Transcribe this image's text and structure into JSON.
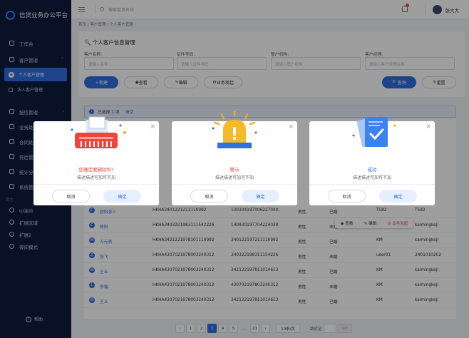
{
  "app": {
    "title": "信贷业务办公平台"
  },
  "sidebar": {
    "workbench": "工作台",
    "customer_mgmt": "客户管理",
    "personal_customer": "个人客户管理",
    "corporate_customer": "法人客户管理",
    "items": [
      "授信管理",
      "业务处理",
      "合同处理",
      "贷后管理",
      "统计分析",
      "系统管理"
    ],
    "section_other": "其它",
    "other_items": [
      "UI演示",
      "扩展区域",
      "扩展2",
      "夜间模式"
    ],
    "help": "帮助"
  },
  "topbar": {
    "search_placeholder": "搜索菜单名称",
    "username": "张大大"
  },
  "breadcrumb": "首页 / 客户管理 / 个人客户管理",
  "page": {
    "title": "个人客户信息管理",
    "fields": [
      {
        "label": "客户名称:",
        "placeholder": "请输入名称"
      },
      {
        "label": "证件号码:",
        "placeholder": "请输入证件号码"
      },
      {
        "label": "管户机构:",
        "placeholder": "请输入管户机构"
      },
      {
        "label": "客户经理:",
        "placeholder": "请输入客户经理名称"
      }
    ],
    "buttons": {
      "new": "新建",
      "view": "查看",
      "edit": "编辑",
      "business": "业务发起",
      "query": "查询",
      "reset": "重置"
    }
  },
  "selection": {
    "text": "已选择 1 项",
    "clear": "清空"
  },
  "table_rows": [
    {
      "initial": "C",
      "name": "欧阳张三",
      "id": "HKHA3401221211110992",
      "cert": "13030419700622704X",
      "gender": "男性",
      "status": "已婚",
      "mgr": "T582",
      "extra": "T582"
    },
    {
      "initial": "C",
      "name": "陈阳",
      "id": "HKHA3403221983111542226",
      "cert": "140930197704224038",
      "gender": "男性",
      "status": "未婚",
      "mgr": "KM",
      "extra": "kaimingkeji"
    },
    {
      "initial": "W",
      "name": "万元表",
      "id": "HKHA3421221978101110992",
      "cert": "340122197211110992",
      "gender": "男性",
      "status": "已婚",
      "mgr": "KM",
      "extra": "kaimingkeji"
    },
    {
      "initial": "Z",
      "name": "张飞",
      "id": "HKHA4307021978003240312",
      "cert": "340322198311154226",
      "gender": "男性",
      "status": "未婚",
      "mgr": "user01",
      "extra": "3401010202"
    },
    {
      "initial": "W",
      "name": "王五",
      "id": "HKHA4307021978003240312",
      "cert": "342122197811014613",
      "gender": "男性",
      "status": "已婚",
      "mgr": "KM",
      "extra": "kaimingkeji"
    },
    {
      "initial": "L",
      "name": "李福",
      "id": "HKHA4307021978003240312",
      "cert": "430702197803240312",
      "gender": "男性",
      "status": "未婚",
      "mgr": "KM",
      "extra": "kaimingkeji"
    },
    {
      "initial": "W",
      "name": "王五",
      "id": "HKHA4307021978003240312",
      "cert": "342122197811014613",
      "gender": "男性",
      "status": "已婚",
      "mgr": "KM",
      "extra": "kaimingkeji"
    }
  ],
  "row_actions": {
    "view": "查看",
    "edit": "编辑",
    "business": "业务发起"
  },
  "pager": {
    "pages": [
      "1",
      "2",
      "3",
      "4",
      "5",
      "...",
      "21"
    ],
    "current": "3",
    "page_size": "10条/页",
    "jump_label": "跳转至",
    "go": "GO"
  },
  "modals": [
    {
      "title": "您确定要删除吗?",
      "desc": "描述描述可加可不加",
      "cancel": "取消",
      "ok": "确定",
      "title_color": "#f0433b"
    },
    {
      "title": "警示",
      "desc": "描述描述可加可不加",
      "cancel": "取消",
      "ok": "确定",
      "title_color": "#f0433b"
    },
    {
      "title": "成功",
      "desc": "描述描述可加可不加",
      "cancel": "取消",
      "ok": "确定",
      "title_color": "#2f6fe0"
    }
  ],
  "colors": {
    "primary": "#2f6fe0",
    "danger": "#f0433b",
    "sidebar": "#0e1c3d"
  }
}
